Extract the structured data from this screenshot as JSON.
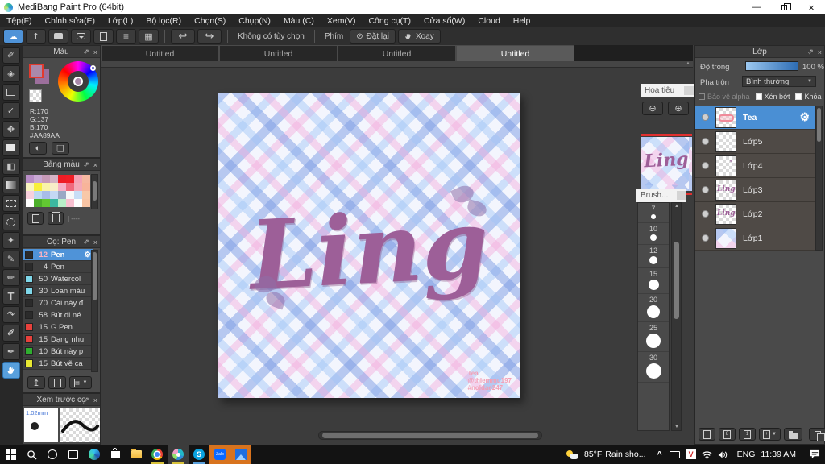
{
  "window": {
    "title": "MediBang Paint Pro (64bit)"
  },
  "icons": {
    "minimize": "—",
    "close_win": "×",
    "popout": "⇗",
    "close": "×",
    "caret_down": "▼",
    "gear": "⚙",
    "cloud": "☁",
    "undo": "↩",
    "redo": "↪",
    "slash": "⊘",
    "zoom_out": "⊖",
    "zoom_in": "⊕",
    "upload": "↥",
    "arrow_up_small": "▲",
    "arrow_down_small": "▼",
    "chevron_up": "^"
  },
  "menu": {
    "items": [
      "Tệp(F)",
      "Chỉnh sửa(E)",
      "Lớp(L)",
      "Bộ lọc(R)",
      "Chọn(S)",
      "Chụp(N)",
      "Màu (C)",
      "Xem(V)",
      "Công cụ(T)",
      "Cửa sổ(W)",
      "Cloud",
      "Help"
    ]
  },
  "toolbar": {
    "no_option": "Không có tùy chọn",
    "key_label": "Phím",
    "reset_label": "Đặt lại",
    "rotate_label": "Xoay"
  },
  "tools": {
    "items": [
      {
        "name": "brush-tool",
        "glyph": "✐"
      },
      {
        "name": "eraser-tool",
        "glyph": "◈"
      },
      {
        "name": "shape-brush-tool",
        "glyph": ""
      },
      {
        "name": "polyline-tool",
        "glyph": "✓"
      },
      {
        "name": "move-tool",
        "glyph": "✥"
      },
      {
        "name": "fill-rect-tool",
        "glyph": ""
      },
      {
        "name": "bucket-tool",
        "glyph": "◧"
      },
      {
        "name": "gradient-tool",
        "glyph": ""
      },
      {
        "name": "select-tool",
        "glyph": ""
      },
      {
        "name": "lasso-tool",
        "glyph": ""
      },
      {
        "name": "magic-wand-tool",
        "glyph": "✦"
      },
      {
        "name": "select-pen-tool",
        "glyph": "✎"
      },
      {
        "name": "select-eraser-tool",
        "glyph": "✏"
      },
      {
        "name": "text-tool",
        "glyph": "T"
      },
      {
        "name": "rotate-view-tool",
        "glyph": "↷"
      },
      {
        "name": "eraser-pen-tool",
        "glyph": "✐"
      },
      {
        "name": "eyedropper-tool",
        "glyph": "✒"
      },
      {
        "name": "hand-tool",
        "glyph": ""
      }
    ]
  },
  "panels": {
    "color": {
      "title": "Màu",
      "r": "R:170",
      "g": "G:137",
      "b": "B:170",
      "hex": "#AA89AA",
      "fg": "#aa89aa",
      "bg2": "#9c6f9c"
    },
    "palette": {
      "title": "Bảng màu",
      "divider_text": "| ----",
      "colors": [
        "#b98ec7",
        "#c9a8d4",
        "#c79ab8",
        "#d4b2c4",
        "#ee1c25",
        "#f01e26",
        "#f4a3b5",
        "#f6b8a0",
        "#f8f4c0",
        "#f8ef3c",
        "#f9f3a8",
        "#f8edc8",
        "#f6aec6",
        "#f06a7e",
        "#f4aab8",
        "#f8b49a",
        "#f8d0dc",
        "#bcd8f0",
        "#a8bce8",
        "#c4d8f4",
        "#9aa8c4",
        "#f8f8f8",
        "#c8ddf6",
        "#f8c8a8",
        "#ffffff",
        "#4caf2a",
        "#62c832",
        "#3cb8a0",
        "#b8eec8",
        "#f8c0d0",
        "#fdfdfd",
        "#f8c4a4"
      ]
    },
    "brush": {
      "title": "Cọ: Pen",
      "items": [
        {
          "size": "12",
          "name": "Pen",
          "color": "#2b2b2b",
          "selected": true
        },
        {
          "size": "4",
          "name": "Pen",
          "color": "#2b2b2b"
        },
        {
          "size": "50",
          "name": "Watercol",
          "color": "#7fd8ea"
        },
        {
          "size": "30",
          "name": "Loan màu",
          "color": "#7fd8ea"
        },
        {
          "size": "70",
          "name": "Cái này đ",
          "color": "#2b2b2b"
        },
        {
          "size": "58",
          "name": "Bút đi né",
          "color": "#2b2b2b"
        },
        {
          "size": "15",
          "name": "G Pen",
          "color": "#e8413c"
        },
        {
          "size": "15",
          "name": "Dạng nhu",
          "color": "#e8413c"
        },
        {
          "size": "10",
          "name": "Bút này p",
          "color": "#2fae2f"
        },
        {
          "size": "15",
          "name": "Bút vẽ ca",
          "color": "#e8e832"
        }
      ]
    },
    "preview": {
      "title": "Xem trước cọ",
      "size_label": "1.02mm"
    }
  },
  "tabs": {
    "items": [
      "Untitled",
      "Untitled",
      "Untitled",
      "Untitled"
    ],
    "active_index": 3
  },
  "canvas": {
    "word": "Ling",
    "signature": {
      "line1": "Tea",
      "line2": "@thiemmu197",
      "line3": "#noldae247"
    }
  },
  "navigator": {
    "title": "Hoa tiêu",
    "brush_label": "Brush...",
    "sizes": [
      "7",
      "10",
      "12",
      "15",
      "20",
      "25",
      "30"
    ]
  },
  "layers": {
    "title": "Lớp",
    "opacity_label": "Độ trong",
    "opacity_value": "100 %",
    "blend_label": "Pha trộn",
    "blend_value": "Bình thường",
    "checks": [
      "Bảo vệ alpha",
      "Xén bớt",
      "Khóa"
    ],
    "items": [
      {
        "name": "Tea",
        "selected": true,
        "thumb": "tea"
      },
      {
        "name": "Lớp5",
        "thumb": "empty"
      },
      {
        "name": "Lớp4",
        "thumb": "empty"
      },
      {
        "name": "Lớp3",
        "thumb": "word"
      },
      {
        "name": "Lớp2",
        "thumb": "word"
      },
      {
        "name": "Lớp1",
        "thumb": "plaid"
      }
    ]
  },
  "taskbar": {
    "weather_temp": "85°F",
    "weather_desc": "Rain sho...",
    "lang": "ENG",
    "time": "11:39 AM"
  }
}
